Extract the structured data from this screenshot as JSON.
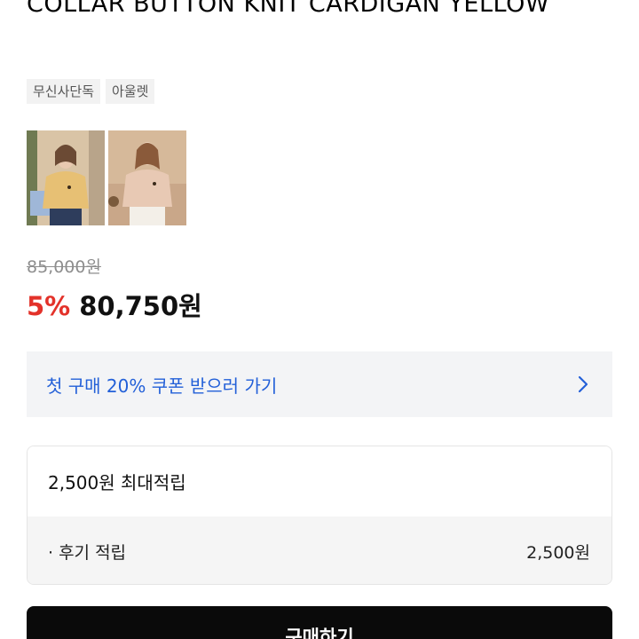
{
  "product": {
    "title": "COLLAR BUTTON KNIT CARDIGAN YELLOW",
    "tags": [
      "무신사단독",
      "아울렛"
    ]
  },
  "thumbnails": [
    {
      "icon": "product-photo-yellow-cardigan",
      "selected": true
    },
    {
      "icon": "product-photo-beige-cardigan",
      "selected": false
    }
  ],
  "price": {
    "original": "85,000원",
    "discount": "5%",
    "sale": "80,750원"
  },
  "coupon": {
    "text": "첫 구매 20% 쿠폰 받으러 가기",
    "icon": "chevron-right-icon"
  },
  "points": {
    "header": "2,500원 최대적립",
    "row_label": "· 후기 적립",
    "row_value": "2,500원"
  },
  "buy_button": {
    "label": "구매하기"
  },
  "colors": {
    "discount": "#e3322a",
    "coupon_link": "#2360d8",
    "button_bg": "#0a0a0a"
  }
}
